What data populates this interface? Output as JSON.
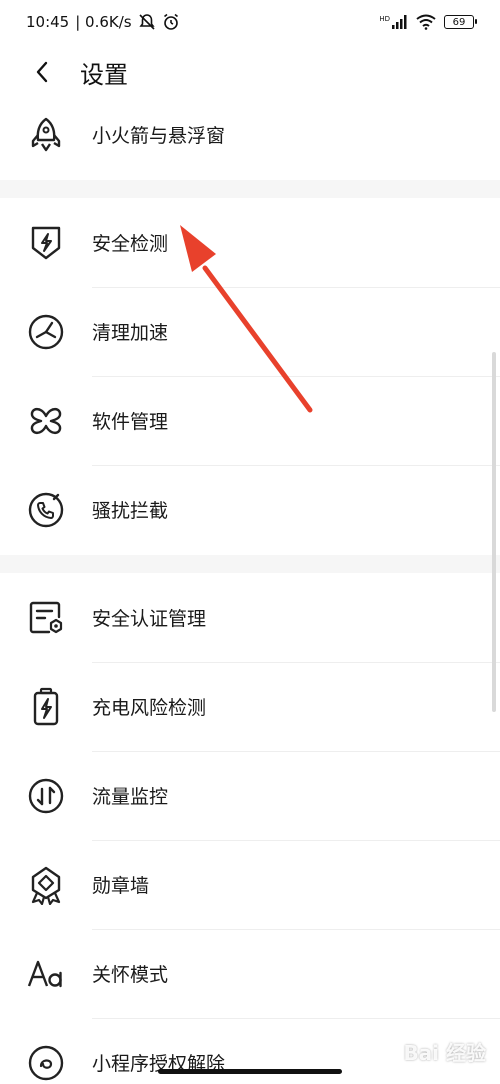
{
  "status_bar": {
    "time": "10:45",
    "speed": "| 0.6K/s",
    "network": "HD",
    "battery": "69"
  },
  "header": {
    "title": "设置"
  },
  "items": [
    {
      "label": "小火箭与悬浮窗",
      "icon": "rocket-icon"
    },
    {
      "label": "安全检测",
      "icon": "shield-bolt-icon"
    },
    {
      "label": "清理加速",
      "icon": "clean-speed-icon"
    },
    {
      "label": "软件管理",
      "icon": "app-manage-icon"
    },
    {
      "label": "骚扰拦截",
      "icon": "phone-block-icon"
    },
    {
      "label": "安全认证管理",
      "icon": "certificate-icon"
    },
    {
      "label": "充电风险检测",
      "icon": "battery-bolt-icon"
    },
    {
      "label": "流量监控",
      "icon": "traffic-icon"
    },
    {
      "label": "勋章墙",
      "icon": "medal-icon"
    },
    {
      "label": "关怀模式",
      "icon": "font-size-icon"
    },
    {
      "label": "小程序授权解除",
      "icon": "mini-program-icon"
    }
  ],
  "annotation": {
    "arrow_color": "#e8412c"
  },
  "watermark": "Bai 经验"
}
